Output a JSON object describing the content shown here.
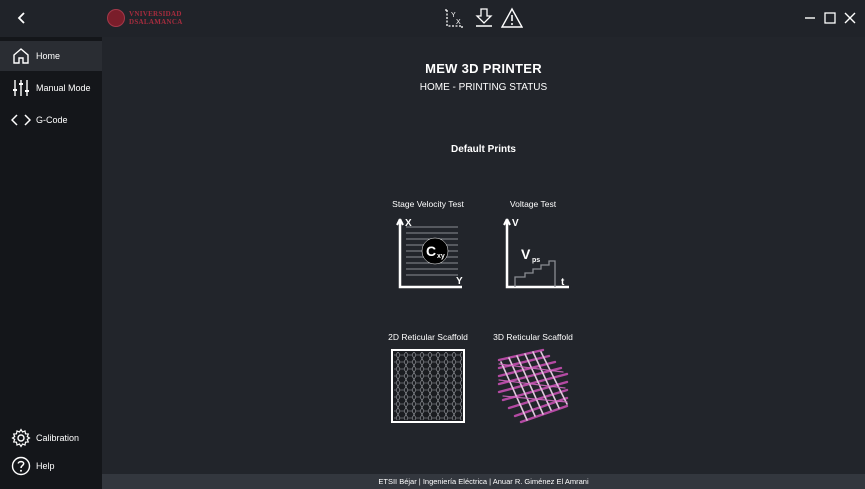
{
  "topbar": {
    "logo_text_line1": "VNIVERSIDAD",
    "logo_text_line2": "DSALAMANCA",
    "icons": [
      "axis-reset-icon",
      "download-icon",
      "warning-icon"
    ],
    "window_controls": [
      "minimize-icon",
      "maximize-icon",
      "close-icon"
    ]
  },
  "sidebar": {
    "items": [
      {
        "label": "Home",
        "icon": "home-icon",
        "active": true
      },
      {
        "label": "Manual Mode",
        "icon": "sliders-icon",
        "active": false
      },
      {
        "label": "G-Code",
        "icon": "code-icon",
        "active": false
      }
    ],
    "bottom_items": [
      {
        "label": "Calibration",
        "icon": "gear-icon"
      },
      {
        "label": "Help",
        "icon": "help-icon"
      }
    ]
  },
  "main": {
    "title": "MEW 3D PRINTER",
    "subtitle": "HOME - PRINTING STATUS",
    "section_title": "Default Prints",
    "prints": [
      {
        "label": "Stage Velocity Test",
        "axis_x": "Y",
        "axis_y": "X",
        "badge": "C",
        "badge_sub": "xy"
      },
      {
        "label": "Voltage Test",
        "axis_x": "t",
        "axis_y": "V",
        "badge": "V",
        "badge_sub": "ps"
      },
      {
        "label": "2D Reticular Scaffold"
      },
      {
        "label": "3D Reticular Scaffold"
      }
    ]
  },
  "footer": {
    "text": "ETSII Béjar | Ingeniería Eléctrica | Anuar R. Giménez El Amrani"
  },
  "colors": {
    "background": "#22252b",
    "sidebar": "#14161a",
    "logo_red": "#a62c3e",
    "scaffold_purple": "#b44aa3"
  }
}
